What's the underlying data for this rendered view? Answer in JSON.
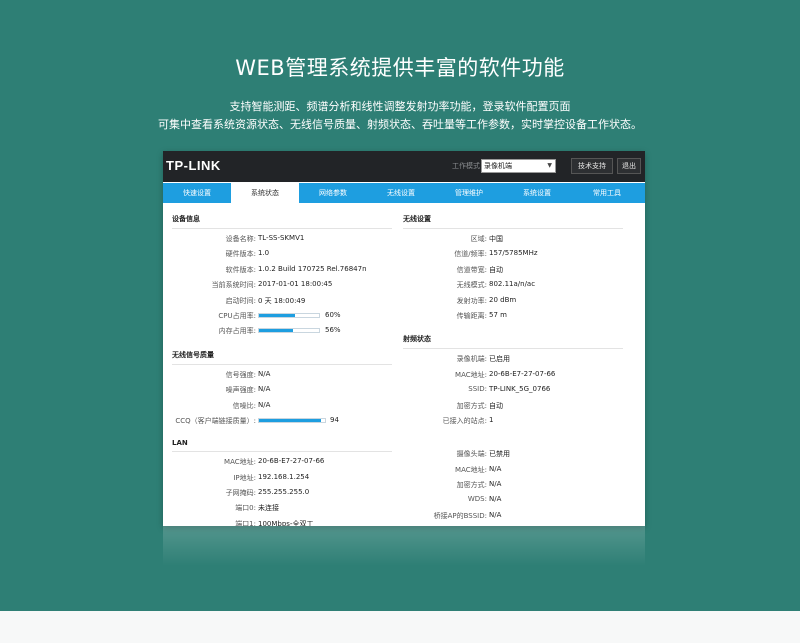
{
  "hero": {
    "title": "WEB管理系统提供丰富的软件功能",
    "line1": "支持智能测距、频谱分析和线性调整发射功率功能，登录软件配置页面",
    "line2": "可集中查看系统资源状态、无线信号质量、射频状态、吞吐量等工作参数，实时掌控设备工作状态。"
  },
  "topbar": {
    "logo": "TP-LINK",
    "mode_label": "工作模式",
    "mode_value": "录像机端",
    "support": "技术支持",
    "exit": "退出"
  },
  "tabs": [
    "快速设置",
    "系统状态",
    "网络参数",
    "无线设置",
    "管理维护",
    "系统设置",
    "常用工具"
  ],
  "active_tab": "系统状态",
  "device": {
    "title": "设备信息",
    "rows": [
      {
        "k": "设备名称:",
        "v": "TL-SS-SKMV1"
      },
      {
        "k": "硬件版本:",
        "v": "1.0"
      },
      {
        "k": "软件版本:",
        "v": "1.0.2 Build 170725 Rel.76847n"
      },
      {
        "k": "当前系统时间:",
        "v": "2017-01-01 18:00:45"
      },
      {
        "k": "启动时间:",
        "v": "0 天 18:00:49"
      }
    ],
    "cpu": {
      "k": "CPU占用率:",
      "v": "60%",
      "fraction": 0.6
    },
    "mem": {
      "k": "内存占用率:",
      "v": "56%",
      "fraction": 0.56
    }
  },
  "signal": {
    "title": "无线信号质量",
    "rows": [
      {
        "k": "信号强度:",
        "v": "N/A"
      },
      {
        "k": "噪声强度:",
        "v": "N/A"
      },
      {
        "k": "信噪比:",
        "v": "N/A"
      }
    ],
    "ccq": {
      "k": "CCQ（客户端链接质量）:",
      "v": "94",
      "fraction": 0.94
    }
  },
  "lan": {
    "title": "LAN",
    "rows": [
      {
        "k": "MAC地址:",
        "v": "20-6B-E7-27-07-66"
      },
      {
        "k": "IP地址:",
        "v": "192.168.1.254"
      },
      {
        "k": "子网掩码:",
        "v": "255.255.255.0"
      },
      {
        "k": "端口0:",
        "v": "未连接"
      },
      {
        "k": "端口1:",
        "v": "100Mbps-全双工"
      }
    ]
  },
  "wireless": {
    "title": "无线设置",
    "rows": [
      {
        "k": "区域:",
        "v": "中国"
      },
      {
        "k": "信道/频率:",
        "v": "157/5785MHz"
      },
      {
        "k": "信道带宽:",
        "v": "自动"
      },
      {
        "k": "无线模式:",
        "v": "802.11a/n/ac"
      },
      {
        "k": "发射功率:",
        "v": "20 dBm"
      },
      {
        "k": "传输距离:",
        "v": "57 m"
      }
    ]
  },
  "rf": {
    "title": "射频状态",
    "rows": [
      {
        "k": "录像机端:",
        "v": "已启用"
      },
      {
        "k": "MAC地址:",
        "v": "20-6B-E7-27-07-66"
      },
      {
        "k": "SSID:",
        "v": "TP-LINK_5G_0766"
      },
      {
        "k": "加密方式:",
        "v": "自动"
      },
      {
        "k": "已接入的站点:",
        "v": "1"
      }
    ],
    "rows2": [
      {
        "k": "摄像头端:",
        "v": "已禁用"
      },
      {
        "k": "MAC地址:",
        "v": "N/A"
      },
      {
        "k": "加密方式:",
        "v": "N/A"
      },
      {
        "k": "WDS:",
        "v": "N/A"
      },
      {
        "k": "桥接AP的BSSID:",
        "v": "N/A"
      }
    ]
  },
  "colors": {
    "teal": "#2e7f75",
    "tab_blue": "#1e9ee0",
    "topbar": "#222427"
  }
}
